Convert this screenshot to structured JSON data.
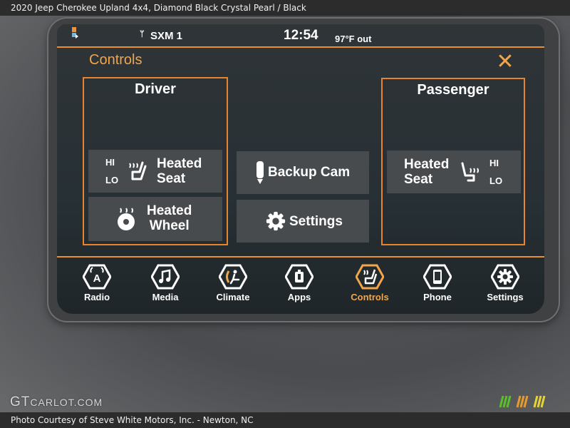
{
  "caption_top": "2020 Jeep Cherokee Upland 4x4,  Diamond Black Crystal Pearl / Black",
  "caption_bottom": "Photo Courtesy of Steve White Motors, Inc. - Newton, NC",
  "watermark": {
    "main": "GT",
    "rest": "CARLOT.COM"
  },
  "status": {
    "radio_source": "SXM 1",
    "time": "12:54",
    "outside_temp": "97°F out",
    "satellite_icon": "satellite-antenna-icon"
  },
  "page": {
    "title": "Controls",
    "close_glyph": "✕"
  },
  "driver": {
    "title": "Driver",
    "heated_seat": {
      "line1": "Heated",
      "line2": "Seat",
      "hi": "HI",
      "lo": "LO"
    },
    "heated_wheel": {
      "line1": "Heated",
      "line2": "Wheel"
    }
  },
  "center": {
    "backup_cam": "Backup Cam",
    "settings": "Settings"
  },
  "passenger": {
    "title": "Passenger",
    "heated_seat": {
      "line1": "Heated",
      "line2": "Seat",
      "hi": "HI",
      "lo": "LO"
    }
  },
  "nav": [
    {
      "label": "Radio",
      "icon": "radio-antenna-icon",
      "active": false
    },
    {
      "label": "Media",
      "icon": "music-note-icon",
      "active": false
    },
    {
      "label": "Climate",
      "icon": "climate-icon",
      "active": false
    },
    {
      "label": "Apps",
      "icon": "apps-icon",
      "active": false
    },
    {
      "label": "Controls",
      "icon": "seat-controls-icon",
      "active": true
    },
    {
      "label": "Phone",
      "icon": "phone-icon",
      "active": false
    },
    {
      "label": "Settings",
      "icon": "gear-icon",
      "active": false
    }
  ],
  "colors": {
    "accent": "#e8922e",
    "accent_text": "#f2a54a",
    "button_bg": "#474b4e",
    "screen_bg": "#2a3135"
  }
}
